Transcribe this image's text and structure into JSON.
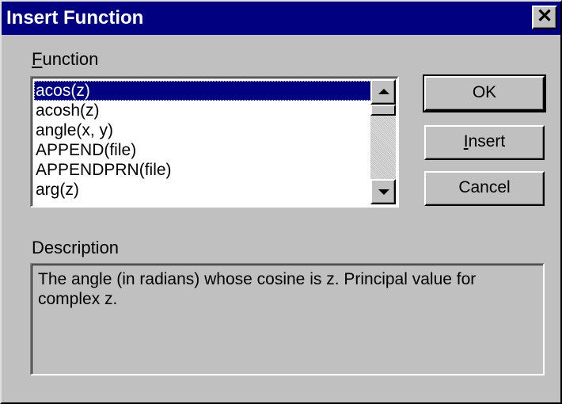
{
  "window": {
    "title": "Insert Function",
    "close_glyph": "✕"
  },
  "function_section": {
    "label_mnemonic": "F",
    "label_rest": "unction",
    "items": [
      "acos(z)",
      "acosh(z)",
      "angle(x, y)",
      "APPEND(file)",
      "APPENDPRN(file)",
      "arg(z)"
    ],
    "selected_index": 0
  },
  "buttons": {
    "ok_label": "OK",
    "insert_mnemonic": "I",
    "insert_rest": "nsert",
    "cancel_label": "Cancel"
  },
  "description_section": {
    "label": "Description",
    "text": "The angle (in radians) whose cosine is z. Principal value for complex z."
  },
  "icons": {
    "close": "close-icon",
    "scroll_up": "scroll-up-arrow-icon",
    "scroll_down": "scroll-down-arrow-icon"
  },
  "colors": {
    "titlebar": "#000080",
    "face": "#c0c0c0",
    "selection": "#000080"
  }
}
